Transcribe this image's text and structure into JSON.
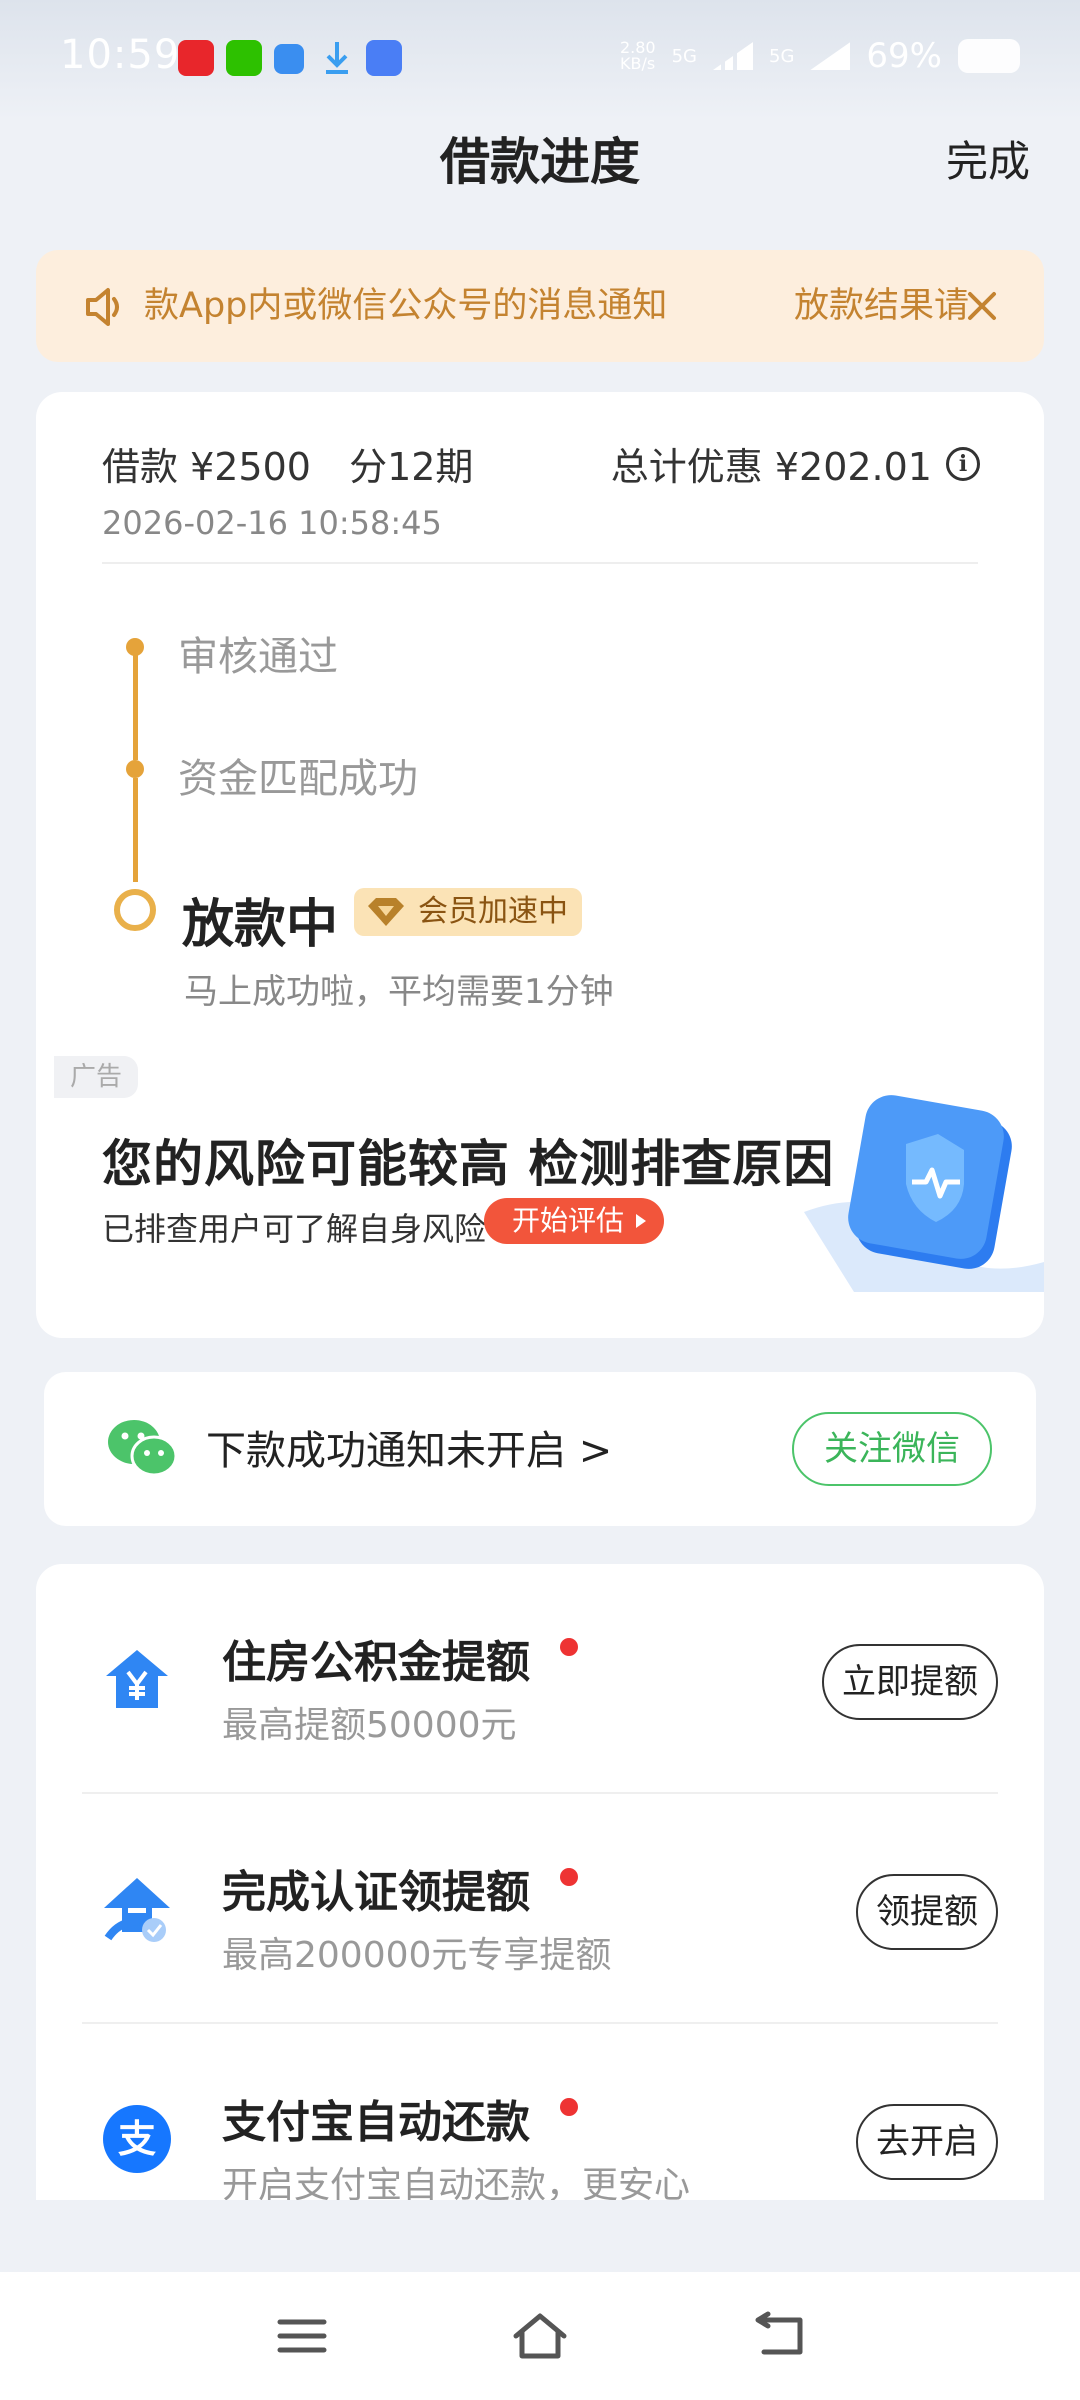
{
  "status_bar": {
    "time": "10:59",
    "speed": "2.80\nKB/s",
    "net1": "5G",
    "net2": "5G",
    "battery": "69%"
  },
  "header": {
    "title": "借款进度",
    "done_label": "完成"
  },
  "notice": {
    "text_left": "款App内或微信公众号的消息通知",
    "text_right": "放款结果请"
  },
  "loan": {
    "amount": "借款 ¥2500",
    "periods": "分12期",
    "saving": "总计优惠 ¥202.01",
    "info": "i",
    "datetime": "2026-02-16 10:58:45"
  },
  "steps": [
    {
      "label": "审核通过"
    },
    {
      "label": "资金匹配成功"
    }
  ],
  "current_step": {
    "label": "放款中",
    "badge": "会员加速中",
    "sub": "马上成功啦，平均需要1分钟"
  },
  "ad": {
    "tag": "广告",
    "title": "您的风险可能较高 检测排查原因",
    "sub": "已排查用户可了解自身风险",
    "button": "开始评估"
  },
  "wechat": {
    "text": "下款成功通知未开启 >",
    "button": "关注微信"
  },
  "items": [
    {
      "title": "住房公积金提额",
      "sub": "最高提额50000元",
      "button": "立即提额"
    },
    {
      "title": "完成认证领提额",
      "sub": "最高200000元专享提额",
      "button": "领提额"
    },
    {
      "title": "支付宝自动还款",
      "sub": "开启支付宝自动还款，更安心",
      "button": "去开启"
    }
  ],
  "colors": {
    "accent": "#e5a33a",
    "notice_bg": "#fdeedd",
    "wechat_green": "#3bb55a",
    "red_dot": "#ee3333",
    "ad_button": "#f2553b"
  }
}
